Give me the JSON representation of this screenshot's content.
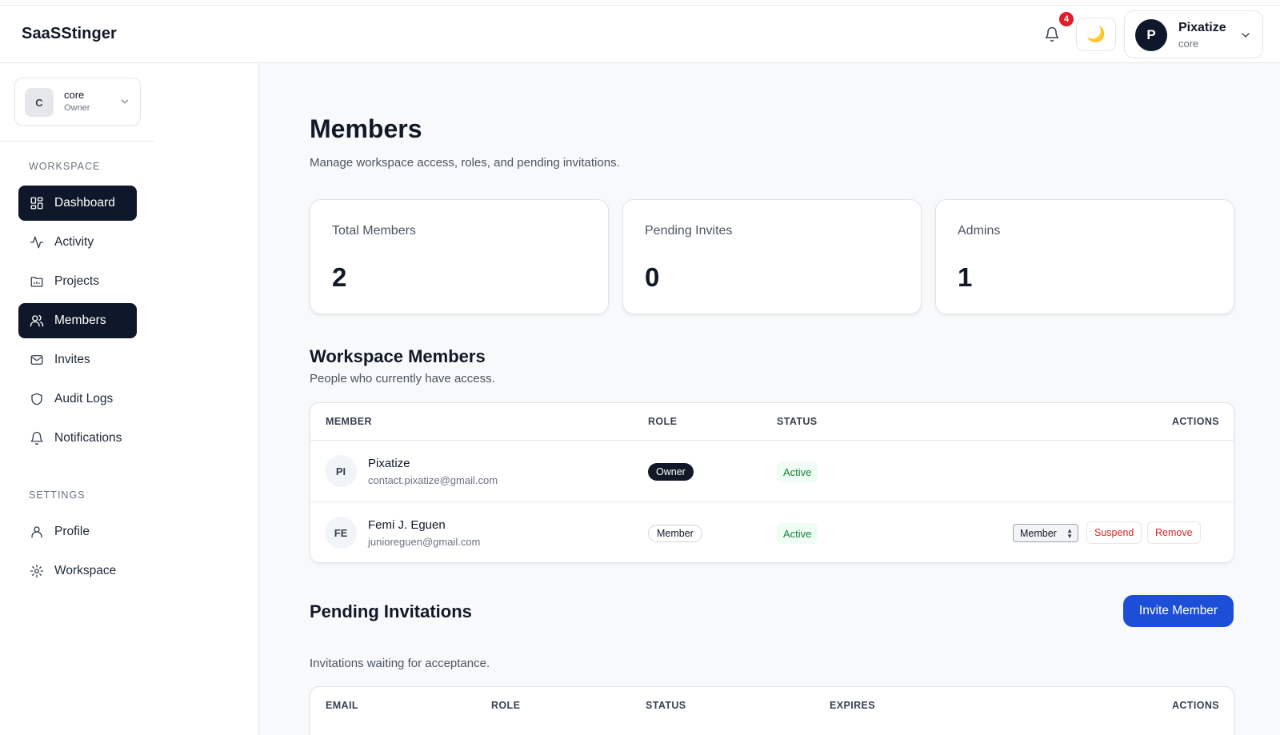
{
  "app": {
    "brand": "SaaSStinger"
  },
  "header": {
    "notifications_count": "4",
    "theme_icon": "moon-icon",
    "user": {
      "initial": "P",
      "name": "Pixatize",
      "workspace": "core"
    }
  },
  "sidebar": {
    "workspace": {
      "initial": "C",
      "name": "core",
      "role": "Owner"
    },
    "sections": {
      "workspace_label": "WORKSPACE",
      "settings_label": "SETTINGS"
    },
    "items": [
      {
        "label": "Dashboard",
        "icon": "dashboard-icon"
      },
      {
        "label": "Activity",
        "icon": "activity-icon"
      },
      {
        "label": "Projects",
        "icon": "folder-icon"
      },
      {
        "label": "Members",
        "icon": "users-icon"
      },
      {
        "label": "Invites",
        "icon": "mail-icon"
      },
      {
        "label": "Audit Logs",
        "icon": "shield-icon"
      },
      {
        "label": "Notifications",
        "icon": "bell-icon"
      },
      {
        "label": "Profile",
        "icon": "user-icon"
      },
      {
        "label": "Workspace",
        "icon": "gear-icon"
      }
    ]
  },
  "main": {
    "title": "Members",
    "subtitle": "Manage workspace access, roles, and pending invitations.",
    "stats": [
      {
        "label": "Total Members",
        "value": "2"
      },
      {
        "label": "Pending Invites",
        "value": "0"
      },
      {
        "label": "Admins",
        "value": "1"
      }
    ],
    "members_section": {
      "title": "Workspace Members",
      "subtitle": "People who currently have access.",
      "columns": [
        "MEMBER",
        "ROLE",
        "STATUS",
        "ACTIONS"
      ],
      "rows": [
        {
          "initials": "PI",
          "name": "Pixatize",
          "email": "contact.pixatize@gmail.com",
          "role": "Owner",
          "status": "Active"
        },
        {
          "initials": "FE",
          "name": "Femi J. Eguen",
          "email": "junioreguen@gmail.com",
          "role": "Member",
          "status": "Active",
          "select_value": "Member",
          "suspend_label": "Suspend",
          "remove_label": "Remove"
        }
      ]
    },
    "invites_section": {
      "title": "Pending Invitations",
      "subtitle": "Invitations waiting for acceptance.",
      "invite_button": "Invite Member",
      "columns": [
        "EMAIL",
        "ROLE",
        "STATUS",
        "EXPIRES",
        "ACTIONS"
      ]
    }
  },
  "colors": {
    "accent": "#1d4ed8",
    "nav_active": "#0f172a",
    "badge_red": "#e11d2a",
    "success": "#16803c",
    "danger": "#dc2626"
  }
}
